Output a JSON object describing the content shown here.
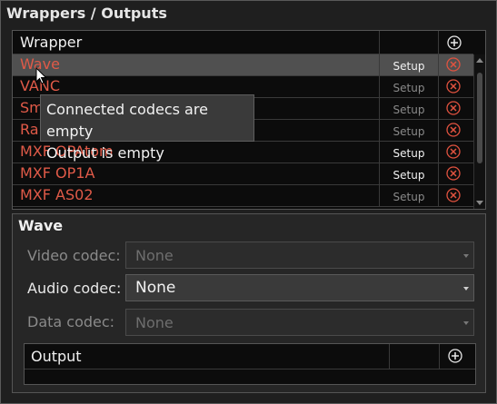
{
  "panel": {
    "title": "Wrappers / Outputs"
  },
  "wrappers": {
    "header": "Wrapper",
    "rows": [
      {
        "name": "Wave",
        "setup": "Setup",
        "selected": true,
        "setup_dim": false
      },
      {
        "name": "VANC",
        "setup": "Setup",
        "selected": false,
        "setup_dim": true
      },
      {
        "name": "Sm",
        "setup": "Setup",
        "selected": false,
        "setup_dim": true
      },
      {
        "name": "Ra",
        "setup": "Setup",
        "selected": false,
        "setup_dim": true
      },
      {
        "name": "MXF OPAtom",
        "setup": "Setup",
        "selected": false,
        "setup_dim": false
      },
      {
        "name": "MXF OP1A",
        "setup": "Setup",
        "selected": false,
        "setup_dim": false
      },
      {
        "name": "MXF AS02",
        "setup": "Setup",
        "selected": false,
        "setup_dim": true
      }
    ]
  },
  "tooltip": {
    "line1": "Connected codecs are empty",
    "line2": "Output is empty"
  },
  "detail": {
    "title": "Wave",
    "video": {
      "label": "Video codec:",
      "value": "None"
    },
    "audio": {
      "label": "Audio codec:",
      "value": "None"
    },
    "data": {
      "label": "Data codec:",
      "value": "None"
    },
    "output": {
      "header": "Output"
    }
  },
  "colors": {
    "wrapper_name": "#e05a48",
    "delete_icon": "#e0523f",
    "selected_row": "#505050"
  }
}
